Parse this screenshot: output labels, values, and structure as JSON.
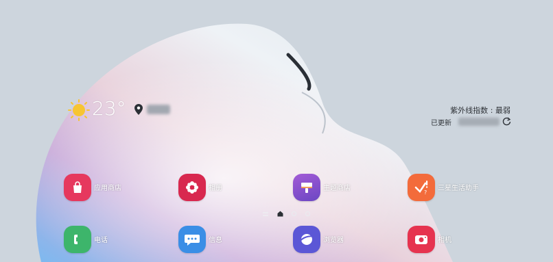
{
  "weather": {
    "temperature": "23°",
    "uv_index": "紫外线指数 : 最弱",
    "updated_label": "已更新"
  },
  "apps": {
    "row1": [
      {
        "label": "应用商店",
        "icon": "bag-icon",
        "color": "#e6385e"
      },
      {
        "label": "相册",
        "icon": "flower-icon",
        "color": "#d8284f"
      },
      {
        "label": "主题商店",
        "icon": "paint-brush-icon",
        "color": "#8b4fc8"
      },
      {
        "label": "三星生活助手",
        "icon": "checkmark-icon",
        "color": "#f36b3b"
      }
    ],
    "row2": [
      {
        "label": "电话",
        "icon": "phone-icon",
        "color": "#3db56b"
      },
      {
        "label": "信息",
        "icon": "chat-icon",
        "color": "#3a8ee6"
      },
      {
        "label": "浏览器",
        "icon": "planet-icon",
        "color": "#5b57d6"
      },
      {
        "label": "相机",
        "icon": "camera-icon",
        "color": "#e6334f"
      }
    ]
  },
  "pager": {
    "pages": 4,
    "current": 2
  }
}
